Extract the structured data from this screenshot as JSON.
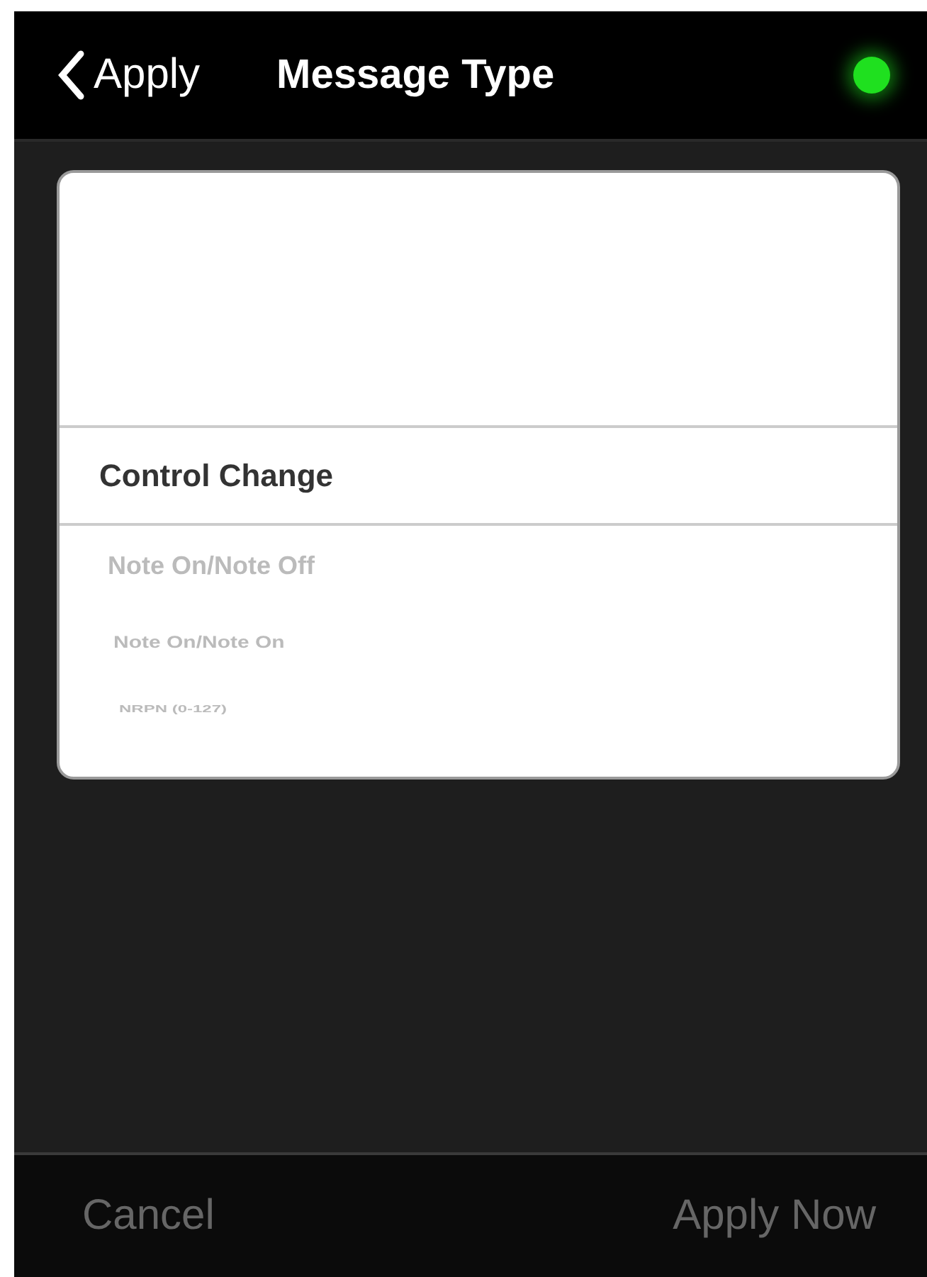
{
  "header": {
    "back_label": "Apply",
    "title": "Message Type",
    "status_light": {
      "on": true
    }
  },
  "picker": {
    "items": [
      {
        "label": "Control Change",
        "selected": true
      },
      {
        "label": "Note On/Note Off",
        "selected": false
      },
      {
        "label": "Note On/Note On",
        "selected": false
      },
      {
        "label": "NRPN (0-127)",
        "selected": false
      }
    ]
  },
  "footer": {
    "buttons": [
      {
        "label": "Cancel",
        "disabled": true
      },
      {
        "label": "Apply Now",
        "disabled": true
      }
    ]
  }
}
